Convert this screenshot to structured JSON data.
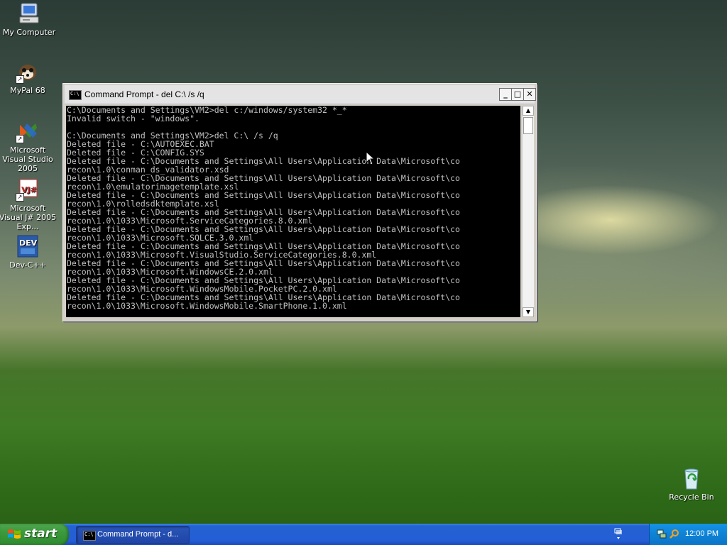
{
  "desktop": {
    "icons": [
      {
        "label": "My Computer"
      },
      {
        "label": "MyPal 68"
      },
      {
        "label": "Microsoft Visual Studio 2005"
      },
      {
        "label": "Microsoft Visual J# 2005 Exp..."
      },
      {
        "label": "Dev-C++"
      },
      {
        "label": "Recycle Bin"
      }
    ]
  },
  "window": {
    "title": "Command Prompt - del C:\\ /s /q",
    "icon_text": "C:\\",
    "buttons": {
      "minimize": "_",
      "maximize": "□",
      "close": "✕"
    },
    "console_lines": [
      "C:\\Documents and Settings\\VM2>del c:/windows/system32 *_*",
      "Invalid switch - \"windows\".",
      "",
      "C:\\Documents and Settings\\VM2>del C:\\ /s /q",
      "Deleted file - C:\\AUTOEXEC.BAT",
      "Deleted file - C:\\CONFIG.SYS",
      "Deleted file - C:\\Documents and Settings\\All Users\\Application Data\\Microsoft\\co",
      "recon\\1.0\\conman_ds_validator.xsd",
      "Deleted file - C:\\Documents and Settings\\All Users\\Application Data\\Microsoft\\co",
      "recon\\1.0\\emulatorimagetemplate.xsl",
      "Deleted file - C:\\Documents and Settings\\All Users\\Application Data\\Microsoft\\co",
      "recon\\1.0\\rolledsdktemplate.xsl",
      "Deleted file - C:\\Documents and Settings\\All Users\\Application Data\\Microsoft\\co",
      "recon\\1.0\\1033\\Microsoft.ServiceCategories.8.0.xml",
      "Deleted file - C:\\Documents and Settings\\All Users\\Application Data\\Microsoft\\co",
      "recon\\1.0\\1033\\Microsoft.SQLCE.3.0.xml",
      "Deleted file - C:\\Documents and Settings\\All Users\\Application Data\\Microsoft\\co",
      "recon\\1.0\\1033\\Microsoft.VisualStudio.ServiceCategories.8.0.xml",
      "Deleted file - C:\\Documents and Settings\\All Users\\Application Data\\Microsoft\\co",
      "recon\\1.0\\1033\\Microsoft.WindowsCE.2.0.xml",
      "Deleted file - C:\\Documents and Settings\\All Users\\Application Data\\Microsoft\\co",
      "recon\\1.0\\1033\\Microsoft.WindowsMobile.PocketPC.2.0.xml",
      "Deleted file - C:\\Documents and Settings\\All Users\\Application Data\\Microsoft\\co",
      "recon\\1.0\\1033\\Microsoft.WindowsMobile.SmartPhone.1.0.xml"
    ]
  },
  "taskbar": {
    "start_label": "start",
    "task_label": "Command Prompt - d...",
    "clock": "12:00 PM"
  },
  "colors": {
    "console_bg": "#000000",
    "console_fg": "#c0c0c0",
    "taskbar_blue": "#245ed6",
    "start_green": "#3b9a3b",
    "tray_blue": "#0e83d6"
  }
}
